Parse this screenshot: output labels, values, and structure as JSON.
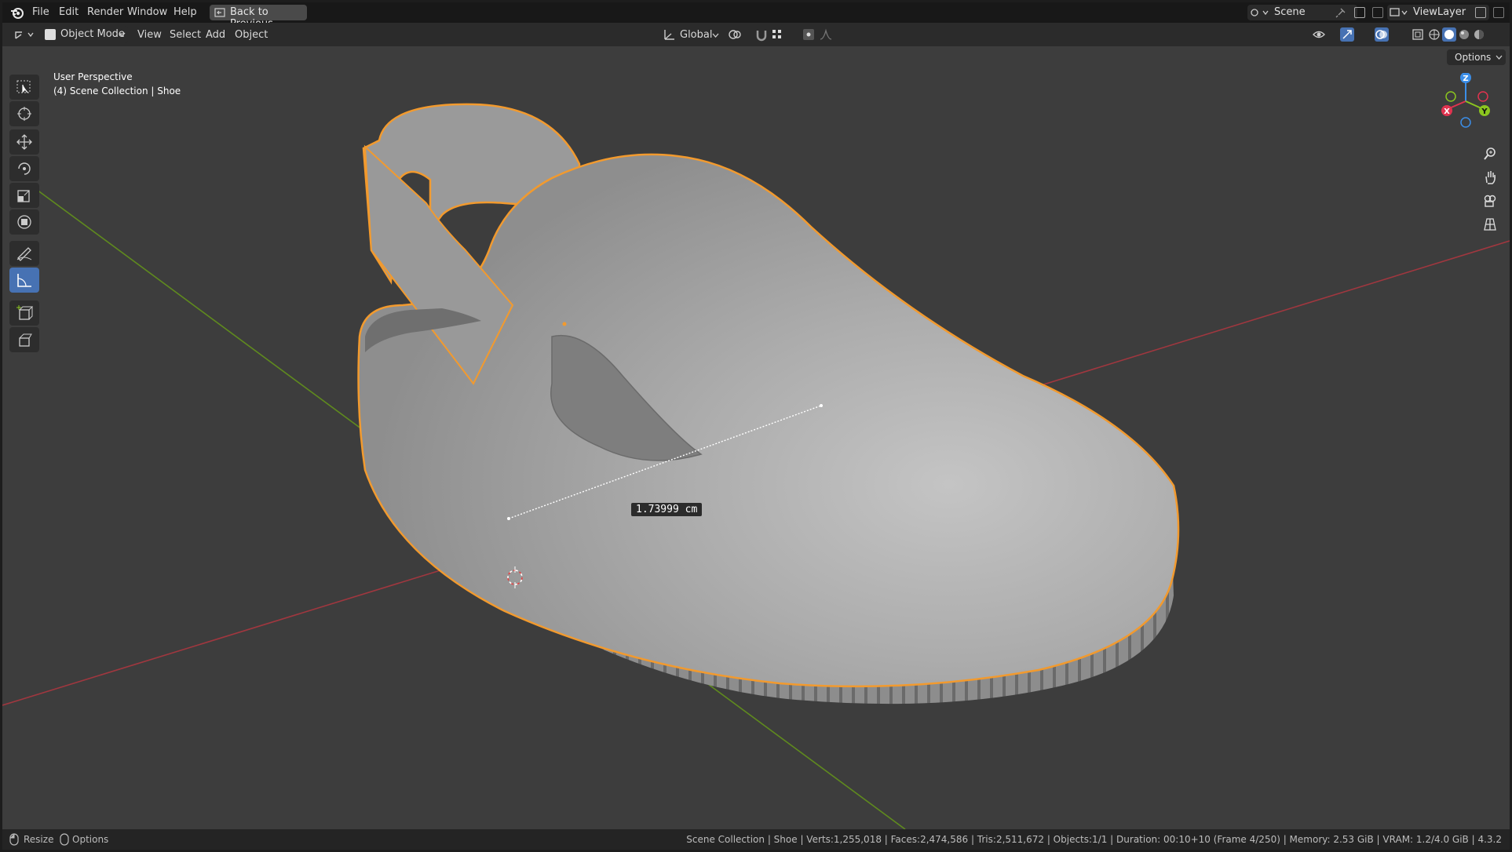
{
  "menubar": {
    "items": [
      "File",
      "Edit",
      "Render",
      "Window",
      "Help"
    ],
    "back_button": "Back to Previous",
    "scene": "Scene",
    "view_layer": "ViewLayer"
  },
  "header": {
    "mode": "Object Mode",
    "menus": [
      "View",
      "Select",
      "Add",
      "Object"
    ],
    "orientation": "Global",
    "options": "Options"
  },
  "viewport": {
    "perspective": "User Perspective",
    "collection": "(4) Scene Collection | Shoe",
    "measurement": "1.73999 cm",
    "gizmo_axes": [
      "X",
      "Y",
      "Z"
    ]
  },
  "status": {
    "resize": "Resize",
    "options": "Options",
    "info": "Scene Collection | Shoe | Verts:1,255,018 | Faces:2,474,586 | Tris:2,511,672 | Objects:1/1 | Duration: 00:10+10 (Frame 4/250) | Memory: 2.53 GiB | VRAM: 1.2/4.0 GiB | 4.3.2"
  },
  "colors": {
    "accent": "#4772b3",
    "selection_outline": "#f29a2e",
    "x_axis": "#a0373f",
    "y_axis": "#5f8a1e",
    "gizmo_x": "#e0334f",
    "gizmo_y": "#8bc51f",
    "gizmo_z": "#3b8ee8"
  }
}
